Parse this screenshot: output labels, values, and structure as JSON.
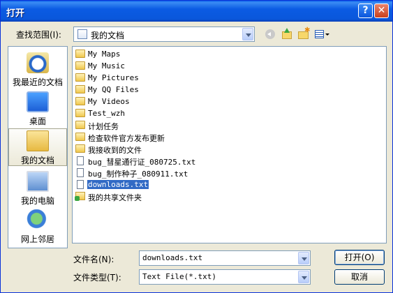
{
  "window": {
    "title": "打开",
    "help_label": "?",
    "close_label": "✕"
  },
  "look_in": {
    "label": "查找范围(I):",
    "value": "我的文档"
  },
  "places": [
    {
      "label": "我最近的文档"
    },
    {
      "label": "桌面"
    },
    {
      "label": "我的文档"
    },
    {
      "label": "我的电脑"
    },
    {
      "label": "网上邻居"
    }
  ],
  "files": [
    {
      "name": "My Maps",
      "icon": "folder-icon"
    },
    {
      "name": "My Music",
      "icon": "folder-icon"
    },
    {
      "name": "My Pictures",
      "icon": "folder-icon"
    },
    {
      "name": "My QQ Files",
      "icon": "folder-icon"
    },
    {
      "name": "My Videos",
      "icon": "folder-icon"
    },
    {
      "name": "Test_wzh",
      "icon": "folder-icon"
    },
    {
      "name": "计划任务",
      "icon": "folder-icon"
    },
    {
      "name": "检查软件官方发布更新",
      "icon": "folder-icon"
    },
    {
      "name": "我接收到的文件",
      "icon": "folder-icon"
    },
    {
      "name": "bug_彗星通行证_080725.txt",
      "icon": "text-file-icon"
    },
    {
      "name": "bug_制作种子_080911.txt",
      "icon": "text-file-icon"
    },
    {
      "name": "downloads.txt",
      "icon": "text-file-icon",
      "selected": true
    },
    {
      "name": "我的共享文件夹",
      "icon": "shared-folder-icon"
    }
  ],
  "file_name": {
    "label": "文件名(N):",
    "value": "downloads.txt"
  },
  "file_type": {
    "label": "文件类型(T):",
    "value": "Text File(*.txt)"
  },
  "buttons": {
    "open": "打开(O)",
    "cancel": "取消"
  }
}
